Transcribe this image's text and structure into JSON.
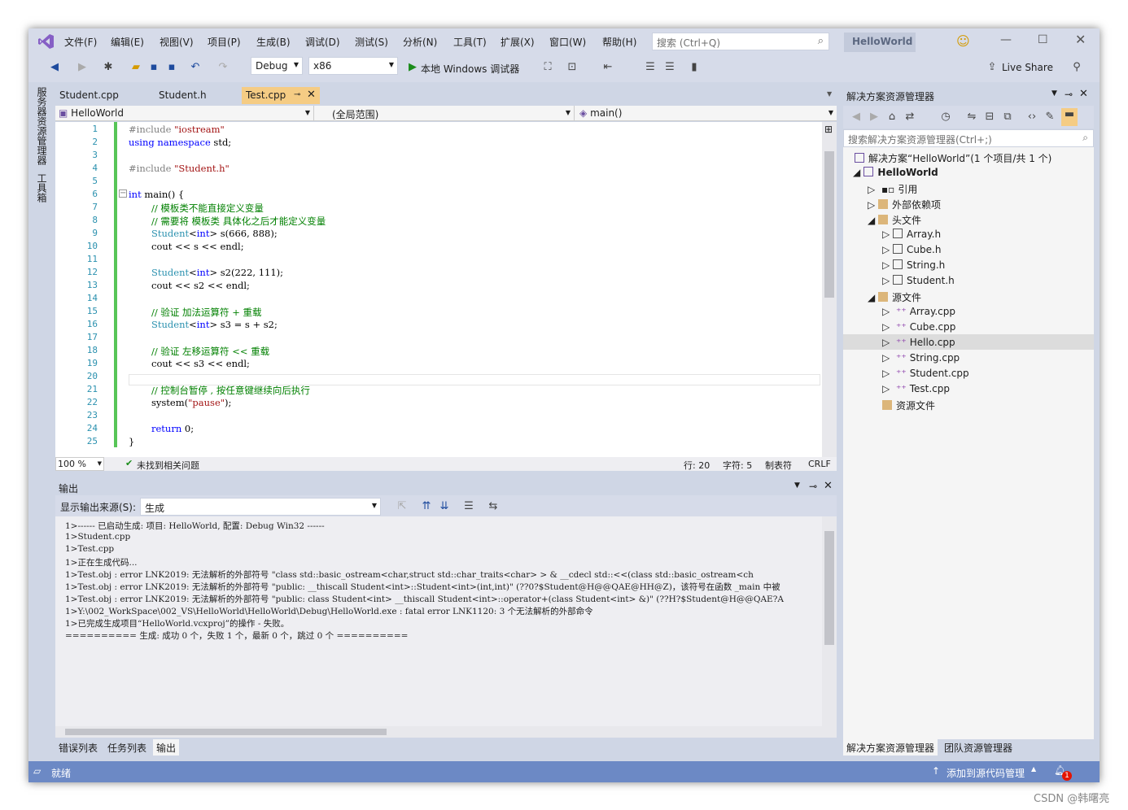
{
  "menubar": {
    "items": [
      "文件(F)",
      "编辑(E)",
      "视图(V)",
      "项目(P)",
      "生成(B)",
      "调试(D)",
      "测试(S)",
      "分析(N)",
      "工具(T)",
      "扩展(X)",
      "窗口(W)",
      "帮助(H)"
    ],
    "search_placeholder": "搜索 (Ctrl+Q)",
    "solution_title": "HelloWorld"
  },
  "toolbar": {
    "config": "Debug",
    "platform": "x86",
    "debugger": "本地 Windows 调试器",
    "live_share": "Live Share"
  },
  "left_strip": {
    "item1": "服务器资源管理器",
    "item2": "工具箱"
  },
  "editor": {
    "tabs": [
      "Student.cpp",
      "Student.h",
      "Test.cpp"
    ],
    "active_tab": "Test.cpp",
    "nav_project": "HelloWorld",
    "nav_scope": "(全局范围)",
    "nav_member": "main()",
    "line_numbers": [
      "1",
      "2",
      "3",
      "4",
      "5",
      "6",
      "7",
      "8",
      "9",
      "10",
      "11",
      "12",
      "13",
      "14",
      "15",
      "16",
      "17",
      "18",
      "19",
      "20",
      "21",
      "22",
      "23",
      "24",
      "25"
    ],
    "zoom": "100 %",
    "issues": "未找到相关问题",
    "row": "行: 20",
    "col": "字符: 5",
    "tabs_mode": "制表符",
    "eol": "CRLF"
  },
  "code": {
    "l1a": "#include",
    "l1b": "\"iostream\"",
    "l2a": "using",
    "l2b": "namespace",
    "l2c": "std;",
    "l4a": "#include",
    "l4b": "\"Student.h\"",
    "l6a": "int",
    "l6b": "main() {",
    "l7": "// 模板类不能直接定义变量",
    "l8": "// 需要将 模板类 具体化之后才能定义变量",
    "l9a": "Student",
    "l9b": "<",
    "l9c": "int",
    ">": ">",
    "l9d": " s(666, 888);",
    "l10": "cout << s << endl;",
    "l12a": "Student",
    "l12c": "int",
    "l12d": " s2(222, 111);",
    "l13": "cout << s2 << endl;",
    "l15": "// 验证 加法运算符 + 重载",
    "l16a": "Student",
    "l16c": "int",
    "l16d": " s3 = s + s2;",
    "l18": "// 验证 左移运算符 << 重载",
    "l19": "cout << s3 << endl;",
    "l21": "// 控制台暂停 , 按任意键继续向后执行",
    "l22a": "system(",
    "l22b": "\"pause\"",
    "l22c": ");",
    "l24a": "return",
    "l24b": " 0;",
    "l25": "}"
  },
  "output": {
    "title": "输出",
    "source_label": "显示输出来源(S):",
    "source_value": "生成",
    "lines": [
      "1>------ 已启动生成: 项目: HelloWorld, 配置: Debug Win32 ------",
      "1>Student.cpp",
      "1>Test.cpp",
      "1>正在生成代码...",
      "1>Test.obj : error LNK2019: 无法解析的外部符号 \"class std::basic_ostream<char,struct std::char_traits<char> > & __cdecl std::<<(class std::basic_ostream<ch",
      "1>Test.obj : error LNK2019: 无法解析的外部符号 \"public: __thiscall Student<int>::Student<int>(int,int)\" (??0?$Student@H@@QAE@HH@Z)，该符号在函数 _main 中被",
      "1>Test.obj : error LNK2019: 无法解析的外部符号 \"public: class Student<int> __thiscall Student<int>::operator+(class Student<int> &)\" (??H?$Student@H@@QAE?A",
      "1>Y:\\002_WorkSpace\\002_VS\\HelloWorld\\HelloWorld\\Debug\\HelloWorld.exe : fatal error LNK1120: 3 个无法解析的外部命令",
      "1>已完成生成项目“HelloWorld.vcxproj”的操作 - 失败。",
      "========== 生成: 成功 0 个，失败 1 个，最新 0 个，跳过 0 个 =========="
    ],
    "bottom_tabs": [
      "错误列表",
      "任务列表",
      "输出"
    ]
  },
  "solution_explorer": {
    "title": "解决方案资源管理器",
    "search_placeholder": "搜索解决方案资源管理器(Ctrl+;)",
    "solution": "解决方案“HelloWorld”(1 个项目/共 1 个)",
    "project": "HelloWorld",
    "refs": "引用",
    "ext_deps": "外部依赖项",
    "headers": "头文件",
    "header_files": [
      "Array.h",
      "Cube.h",
      "String.h",
      "Student.h"
    ],
    "sources": "源文件",
    "source_files": [
      "Array.cpp",
      "Cube.cpp",
      "Hello.cpp",
      "String.cpp",
      "Student.cpp",
      "Test.cpp"
    ],
    "resources": "资源文件",
    "bottom_tabs": [
      "解决方案资源管理器",
      "团队资源管理器"
    ]
  },
  "status": {
    "ready": "就绪",
    "source_control": "添加到源代码管理",
    "notif_count": "1"
  },
  "watermark": "CSDN @韩曙亮"
}
